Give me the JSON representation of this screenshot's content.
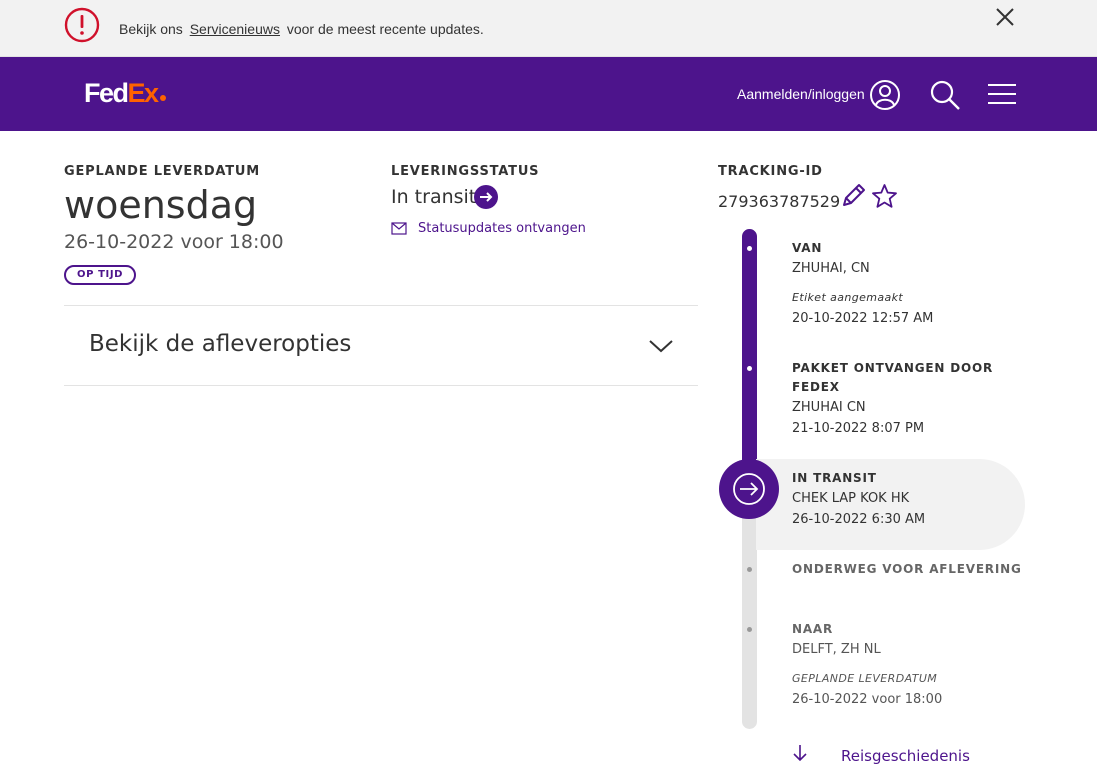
{
  "banner": {
    "prefix": "Bekijk ons",
    "link": "Servicenieuws",
    "suffix": "voor de meest recente updates."
  },
  "header": {
    "logo_fed": "Fed",
    "logo_ex": "Ex",
    "login": "Aanmelden/inloggen"
  },
  "delivery": {
    "label": "GEPLANDE LEVERDATUM",
    "day": "woensdag",
    "date": "26-10-2022 voor 18:00",
    "badge": "OP TIJD"
  },
  "status": {
    "label": "LEVERINGSSTATUS",
    "value": "In transit",
    "updates_link": "Statusupdates ontvangen"
  },
  "tracking": {
    "label": "TRACKING-ID",
    "number": "279363787529"
  },
  "accordion": {
    "title": "Bekijk de afleveropties"
  },
  "timeline": {
    "events": [
      {
        "heading": "VAN",
        "location": "ZHUHAI, CN",
        "note": "Etiket aangemaakt",
        "date": "20-10-2022 12:57 AM"
      },
      {
        "heading_line1": "PAKKET ONTVANGEN DOOR",
        "heading_line2": "FEDEX",
        "location": "ZHUHAI CN",
        "date": "21-10-2022 8:07 PM"
      },
      {
        "heading": "IN TRANSIT",
        "location": "CHEK LAP KOK HK",
        "date": "26-10-2022 6:30 AM"
      },
      {
        "heading": "ONDERWEG VOOR AFLEVERING"
      },
      {
        "heading": "NAAR",
        "location": "DELFT, ZH NL",
        "note": "GEPLANDE LEVERDATUM",
        "date": "26-10-2022 voor 18:00"
      }
    ],
    "history_link": "Reisgeschiedenis"
  },
  "colors": {
    "brand_purple": "#4d148c",
    "brand_orange": "#ff6200",
    "banner_bg": "#f2f2f2"
  }
}
